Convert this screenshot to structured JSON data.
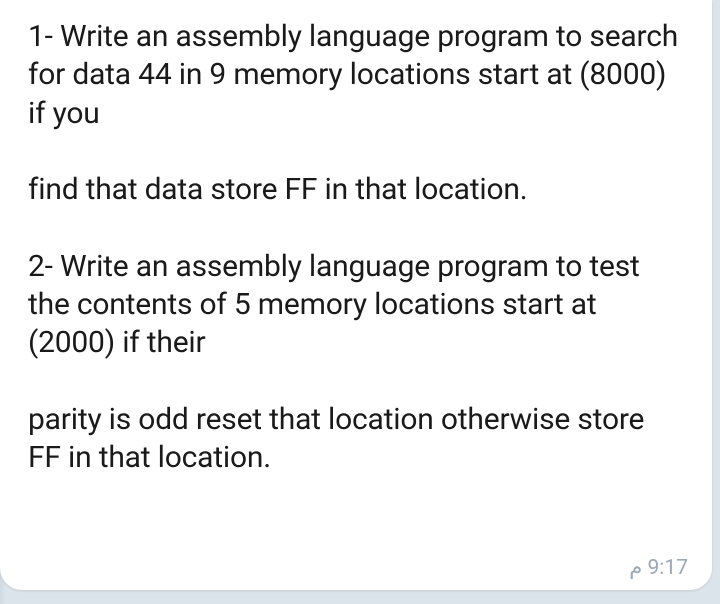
{
  "message": {
    "paragraphs": [
      "1- Write an assembly language program to search for data 44 in 9 memory locations start at (8000) if you",
      "find that data store FF in that location.",
      "2- Write an assembly language program to test the contents of 5 memory locations start at (2000) if their",
      "parity is odd reset that location otherwise store FF in that location."
    ],
    "timestamp": "9:17  م"
  }
}
